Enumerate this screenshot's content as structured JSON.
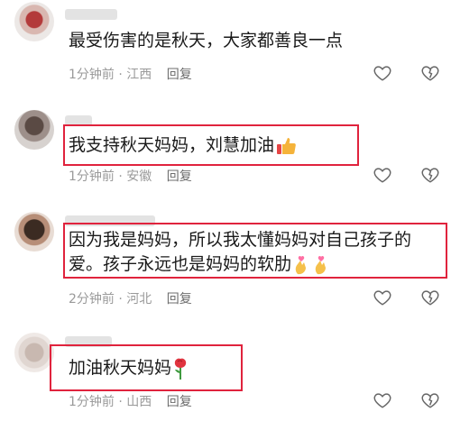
{
  "comments": [
    {
      "text": "最受伤害的是秋天，大家都善良一点",
      "time": "1分钟前",
      "location": "江西",
      "reply_label": "回复"
    },
    {
      "text": "我支持秋天妈妈，刘慧加油",
      "time": "1分钟前",
      "location": "安徽",
      "reply_label": "回复",
      "emoji": "thumbs-up-icon"
    },
    {
      "text_line1": "因为我是妈妈，所以我太懂妈妈对自己孩子的",
      "text_line2": "爱。孩子永远也是妈妈的软肋",
      "time": "2分钟前",
      "location": "河北",
      "reply_label": "回复",
      "emoji": "finger-heart-icon"
    },
    {
      "text": "加油秋天妈妈",
      "time": "1分钟前",
      "location": "山西",
      "reply_label": "回复",
      "emoji": "rose-icon"
    }
  ],
  "separator": "·",
  "colors": {
    "highlight": "#e0233d",
    "meta": "#9a9a9a",
    "text": "#1a1a1a"
  }
}
